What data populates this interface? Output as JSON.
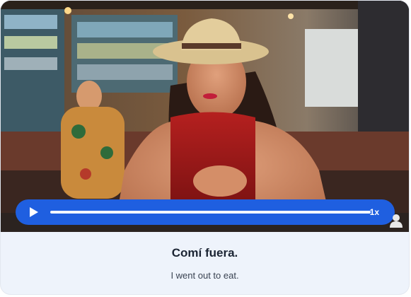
{
  "video": {
    "progress": 0.0,
    "speed_label": "1x"
  },
  "caption": {
    "phrase": "Comí fuera.",
    "translation": "I went out to eat."
  },
  "colors": {
    "control_bar": "#1f5fe0",
    "caption_bg": "#eef3fb"
  },
  "icons": {
    "play": "play-icon",
    "corner": "avatar-icon"
  }
}
